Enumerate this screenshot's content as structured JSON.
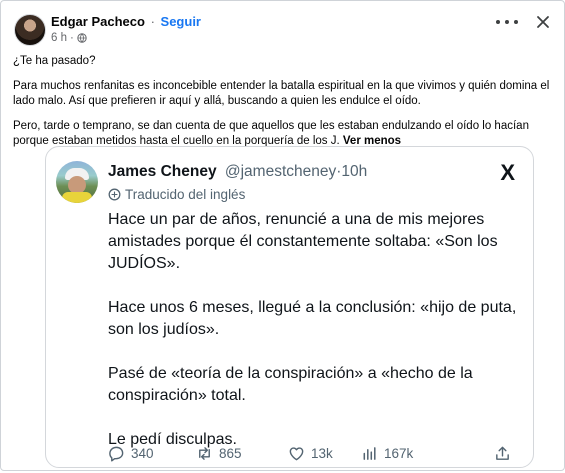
{
  "post": {
    "author": "Edgar Pacheco",
    "separator": "·",
    "follow_label": "Seguir",
    "time": "6 h",
    "time_sep": "·",
    "body": [
      "¿Te ha pasado?",
      "Para muchos renfanitas es inconcebible entender la batalla espiritual en la que vivimos y quién domina el lado malo. Así que prefieren ir aquí y allá, buscando a quien les endulce el oído.",
      "Pero, tarde o temprano, se dan cuenta de que aquellos que les estaban endulzando el oído lo hacían porque estaban metidos hasta el cuello en la porquería de los J."
    ],
    "see_less": "Ver menos"
  },
  "tweet": {
    "name": "James Cheney",
    "handle": "@jamestcheney",
    "time": "·10h",
    "brand": "X",
    "translated_label": "Traducido del inglés",
    "paragraphs": [
      "Hace un par de años, renuncié a una de mis mejores amistades porque él constantemente soltaba: «Son los JUDÍOS».",
      "Hace unos 6 meses, llegué a la conclusión: «hijo de puta, son los judíos».",
      "Pasé de «teoría de la conspiración» a «hecho de la conspiración» total.",
      "Le pedí disculpas."
    ],
    "actions": {
      "replies": "340",
      "reposts": "865",
      "likes": "13k",
      "views": "167k"
    }
  },
  "icons": [
    "globe-icon",
    "more-options-icon",
    "close-icon",
    "x-logo-icon",
    "translate-icon",
    "reply-icon",
    "repost-icon",
    "like-icon",
    "views-icon",
    "share-icon"
  ],
  "colors": {
    "link": "#1877f2",
    "muted": "#65676b",
    "tweet_muted": "#536471"
  }
}
